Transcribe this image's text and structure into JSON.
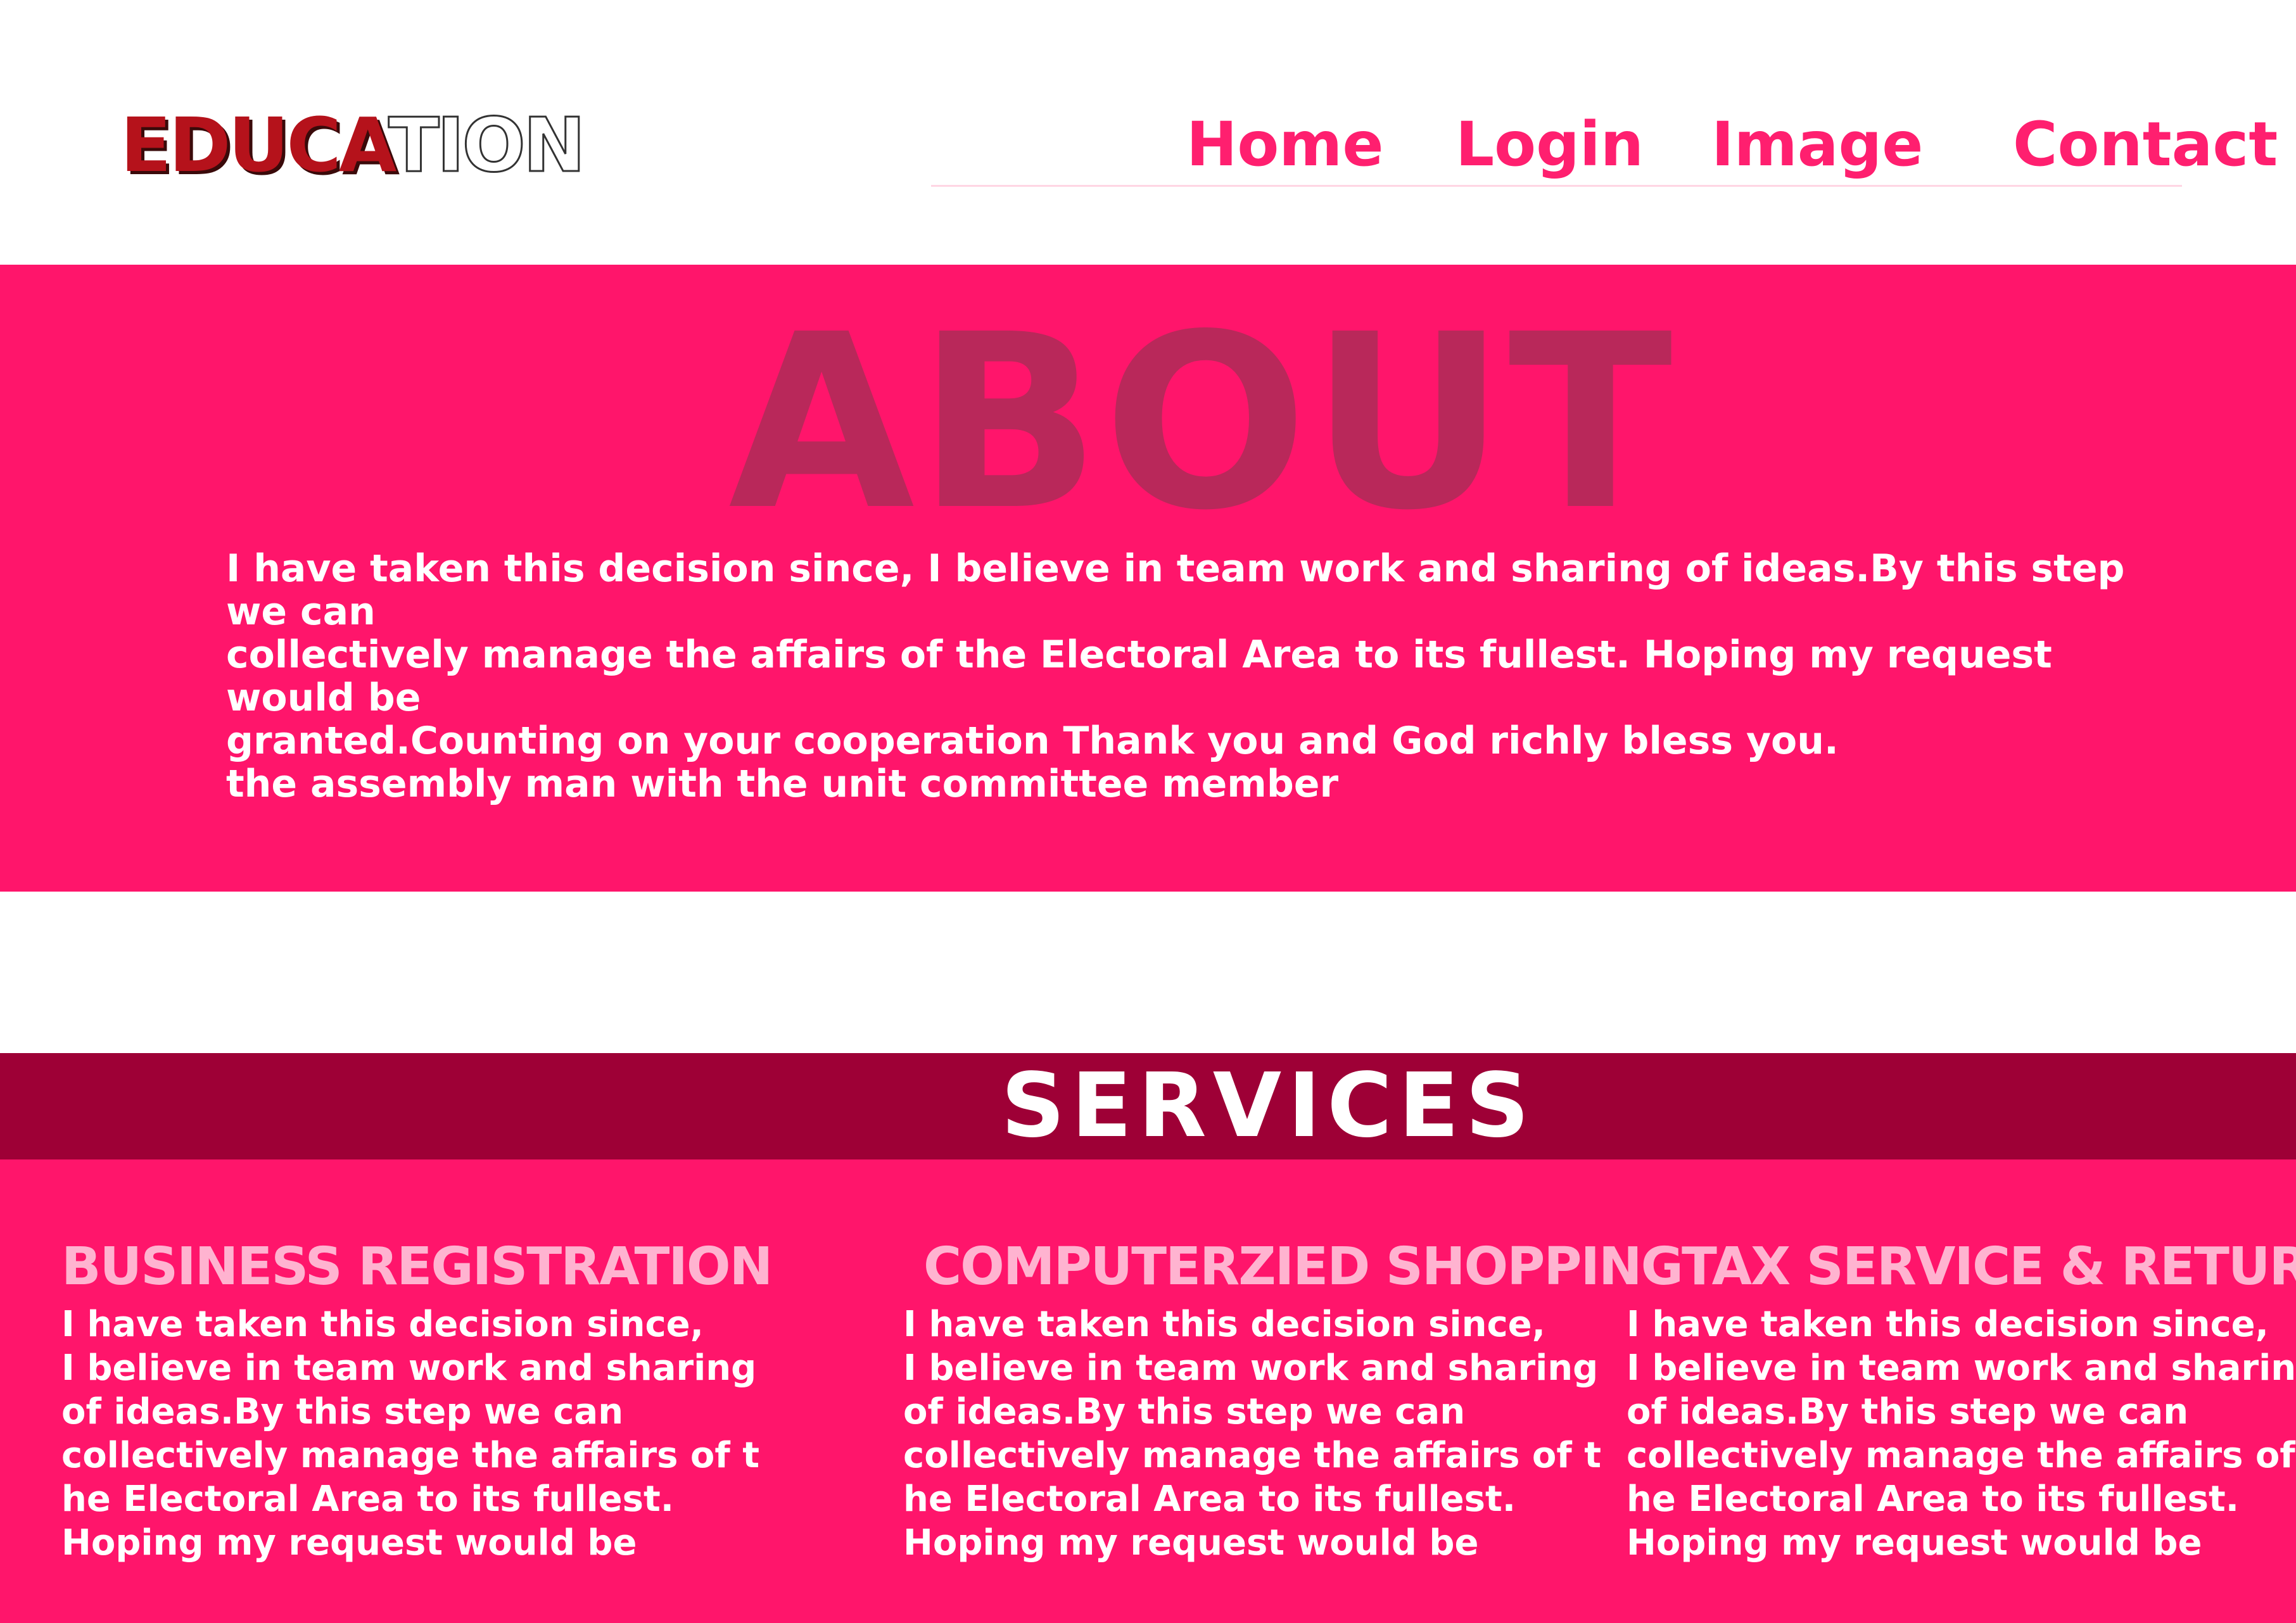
{
  "header": {
    "logo": {
      "bold_part": "EDUCA",
      "light_part": "TION"
    },
    "nav": {
      "home": "Home",
      "login": "Login",
      "image": "Image",
      "contact": "Contact"
    }
  },
  "about": {
    "title": "ABOUT",
    "lines": [
      "I have taken this decision since, I believe in team work and sharing of ideas.By this step we can",
      "collectively manage the affairs of the Electoral Area to its fullest. Hoping my request would be",
      "granted.Counting on your cooperation Thank you and God richly bless you.",
      "the assembly man with the unit committee member"
    ]
  },
  "services": {
    "title": "SERVICES",
    "items": [
      {
        "heading": "BUSINESS REGISTRATION",
        "lines": [
          "I have taken this decision since,",
          "I believe in team work and sharing",
          "of ideas.By this step we can",
          "collectively manage the affairs of t",
          "he Electoral Area to its fullest.",
          "Hoping my request would be"
        ]
      },
      {
        "heading": "COMPUTERZIED SHOPPING",
        "lines": [
          "I have taken this decision since,",
          "I believe in team work and sharing",
          "of ideas.By this step we can",
          "collectively manage the affairs of t",
          "he Electoral Area to its fullest.",
          "Hoping my request would be"
        ]
      },
      {
        "heading": "TAX SERVICE & RETURNS",
        "lines": [
          "I have taken this decision since,",
          "I believe in team work and sharing",
          "of ideas.By this step we can",
          "collectively manage the affairs of t",
          "he Electoral Area to its fullest.",
          "Hoping my request would be"
        ]
      }
    ]
  },
  "colors": {
    "accent_pink": "#ff156b",
    "dark_crimson": "#9e0036",
    "about_title": "#b9285a",
    "service_heading": "#ffb3d0",
    "logo_red": "#b5121b"
  }
}
